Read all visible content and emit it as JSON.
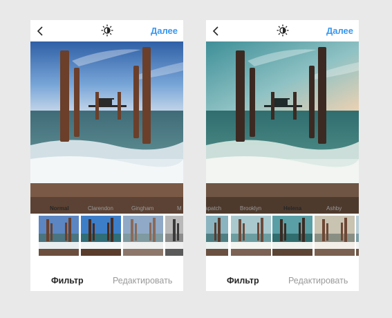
{
  "left_screen": {
    "header": {
      "next_label": "Далее"
    },
    "filters": [
      "Normal",
      "Clarendon",
      "Gingham",
      "M"
    ],
    "active_filter": "Normal",
    "tabs": {
      "filter": "Фильтр",
      "edit": "Редактировать"
    }
  },
  "right_screen": {
    "header": {
      "next_label": "Далее"
    },
    "filters": [
      "apatch",
      "Brooklyn",
      "Helena",
      "Ashby"
    ],
    "active_filter": "Helena",
    "tabs": {
      "filter": "Фильтр",
      "edit": "Редактировать"
    }
  },
  "icons": {
    "back": "chevron-left-icon",
    "lux": "lux-sun-icon"
  },
  "colors": {
    "accent": "#3897f0",
    "background": "#e9e9e9"
  }
}
